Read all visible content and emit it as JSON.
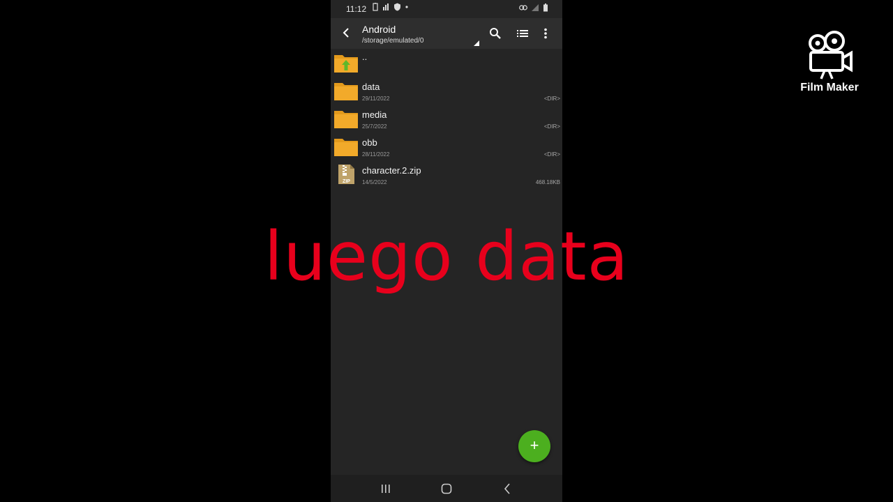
{
  "status": {
    "time": "11:12"
  },
  "toolbar": {
    "title": "Android",
    "path": "/storage/emulated/0"
  },
  "files": [
    {
      "name": "..",
      "date": "",
      "meta": "",
      "type": "up"
    },
    {
      "name": "data",
      "date": "29/11/2022",
      "meta": "<DIR>",
      "type": "folder"
    },
    {
      "name": "media",
      "date": "25/7/2022",
      "meta": "<DIR>",
      "type": "folder"
    },
    {
      "name": "obb",
      "date": "28/11/2022",
      "meta": "<DIR>",
      "type": "folder"
    },
    {
      "name": "character.2.zip",
      "date": "14/5/2022",
      "meta": "468.18KB",
      "type": "zip"
    }
  ],
  "fab": {
    "label": "+"
  },
  "overlay": {
    "caption": "luego data"
  },
  "watermark": {
    "label": "Film Maker"
  },
  "colors": {
    "folder": "#f0a020",
    "fab": "#4caf1f",
    "caption": "#e8001c"
  },
  "icons": {
    "toolbar": [
      "back-icon",
      "search-icon",
      "list-view-icon",
      "more-vert-icon"
    ],
    "nav": [
      "recents-icon",
      "home-icon",
      "back-nav-icon"
    ]
  }
}
